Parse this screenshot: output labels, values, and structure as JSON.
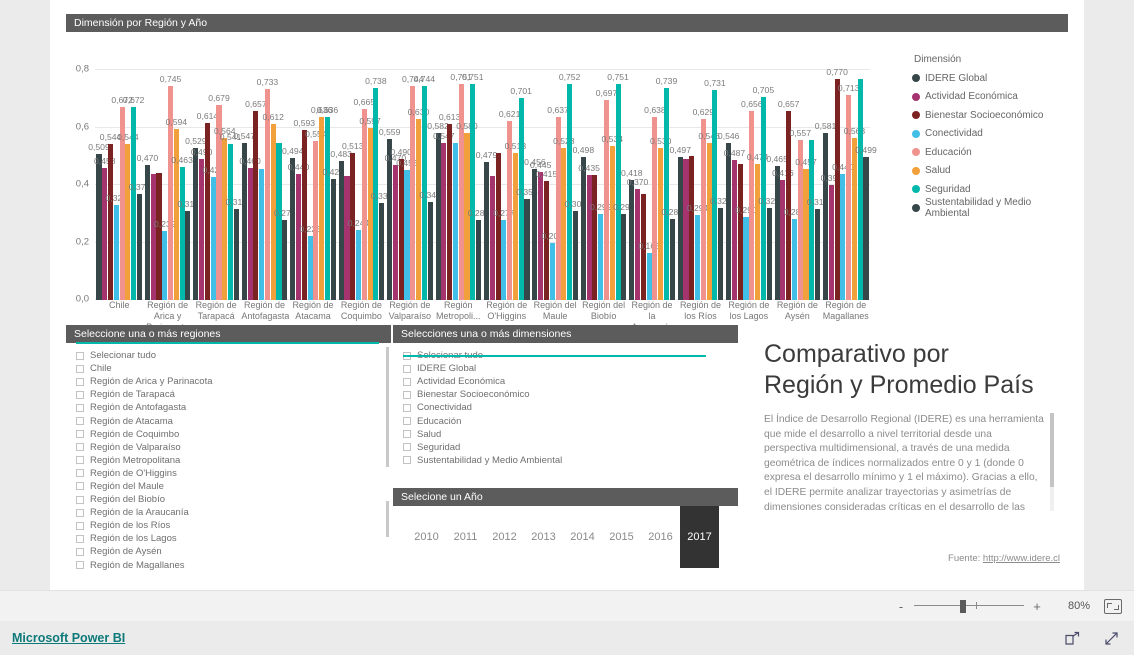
{
  "chart_data": {
    "type": "bar",
    "title": "Dimensión por Región y Año",
    "xlabel": "",
    "ylabel": "",
    "ylim": [
      0,
      0.8
    ],
    "yticks": [
      "0,0",
      "0,2",
      "0,4",
      "0,6",
      "0,8"
    ],
    "grid": true,
    "legend_position": "right",
    "legend_title": "Dimensión",
    "categories": [
      "Chile",
      "Región de Arica y Parinacota",
      "Región de Tarapacá",
      "Región de Antofagasta",
      "Región de Atacama",
      "Región de Coquimbo",
      "Región de Valparaíso",
      "Región Metropoli...",
      "Región de O'Higgins",
      "Región del Maule",
      "Región del Biobío",
      "Región de la Araucanía",
      "Región de los Ríos",
      "Región de los Lagos",
      "Región de Aysén",
      "Región de Magallanes"
    ],
    "series": [
      {
        "name": "IDERE Global",
        "color": "#374649",
        "values": [
          0.509,
          0.47,
          0.529,
          0.547,
          0.494,
          0.483,
          0.559,
          0.582,
          0.479,
          0.456,
          0.498,
          0.418,
          0.497,
          0.546,
          0.465,
          0.581
        ]
      },
      {
        "name": "Actividad Económica",
        "color": "#a4336e",
        "values": [
          0.458,
          0.44,
          0.49,
          0.46,
          0.44,
          0.432,
          0.47,
          0.547,
          0.43,
          0.445,
          0.435,
          0.385,
          0.492,
          0.487,
          0.416,
          0.399
        ]
      },
      {
        "name": "Bienestar Socioeconómico",
        "color": "#7b2222",
        "values": [
          0.544,
          0.441,
          0.614,
          0.657,
          0.593,
          0.513,
          0.49,
          0.613,
          0.513,
          0.415,
          0.436,
          0.37,
          0.5,
          0.474,
          0.657,
          0.77
        ]
      },
      {
        "name": "Conectividad",
        "color": "#41bfe6",
        "values": [
          0.329,
          0.239,
          0.428,
          0.456,
          0.223,
          0.244,
          0.453,
          0.547,
          0.277,
          0.2,
          0.299,
          0.165,
          0.294,
          0.29,
          0.282,
          0.44
        ]
      },
      {
        "name": "Educación",
        "color": "#f0938e",
        "values": [
          0.672,
          0.745,
          0.679,
          0.733,
          0.554,
          0.665,
          0.744,
          0.751,
          0.621,
          0.637,
          0.697,
          0.638,
          0.629,
          0.656,
          0.557,
          0.713
        ]
      },
      {
        "name": "Salud",
        "color": "#f2a03c",
        "values": [
          0.544,
          0.594,
          0.564,
          0.612,
          0.636,
          0.597,
          0.63,
          0.58,
          0.513,
          0.528,
          0.534,
          0.53,
          0.546,
          0.474,
          0.457,
          0.563
        ]
      },
      {
        "name": "Seguridad",
        "color": "#01b8aa",
        "values": [
          0.672,
          0.463,
          0.541,
          0.547,
          0.636,
          0.738,
          0.744,
          0.751,
          0.701,
          0.752,
          0.751,
          0.739,
          0.731,
          0.705,
          0.557,
          0.77
        ]
      },
      {
        "name": "Sustentabilidad y Medio Ambiental",
        "color": "#374649",
        "values": [
          0.37,
          0.311,
          0.316,
          0.278,
          0.421,
          0.337,
          0.34,
          0.28,
          0.353,
          0.309,
          0.299,
          0.281,
          0.321,
          0.321,
          0.316,
          0.499
        ]
      }
    ],
    "data_labels": [
      [
        "0,509",
        "0,458",
        "0,544",
        "0,329",
        "0,672",
        "0,544",
        "0,672",
        "0,370"
      ],
      [
        "0,470",
        "",
        "",
        "0,239",
        "0,745",
        "0,594",
        "0,463",
        "0,311"
      ],
      [
        "0,529",
        "0,490",
        "0,614",
        "0,428",
        "0,679",
        "0,564",
        "0,541",
        "0,316"
      ],
      [
        "0,547",
        "0,460",
        "0,657",
        "",
        "0,733",
        "0,612",
        "",
        "0,278"
      ],
      [
        "0,494",
        "0,440",
        "0,593",
        "0,223",
        "0,554",
        "0,636",
        "0,636",
        "0,421"
      ],
      [
        "0,483",
        "",
        "0,513",
        "0,244",
        "0,665",
        "0,597",
        "0,738",
        "0,337"
      ],
      [
        "0,559",
        "0,470",
        "0,490",
        "0,453",
        "0,744",
        "0,630",
        "0,744",
        "0,340"
      ],
      [
        "0,582",
        "0,547",
        "0,613",
        "",
        "0,751",
        "0,580",
        "0,751",
        "0,280"
      ],
      [
        "0,479",
        "",
        "",
        "0,277",
        "0,621",
        "0,513",
        "0,701",
        "0,353"
      ],
      [
        "0,456",
        "0,445",
        "0,415",
        "0,200",
        "0,637",
        "0,528",
        "0,752",
        "0,309"
      ],
      [
        "0,498",
        "0,435",
        "",
        "0,299",
        "0,697",
        "0,534",
        "0,751",
        "0,299"
      ],
      [
        "0,418",
        "0,370",
        "",
        "0,165",
        "0,638",
        "0,530",
        "0,739",
        "0,281"
      ],
      [
        "0,497",
        "",
        "",
        "0,294",
        "0,629",
        "0,546",
        "0,731",
        "0,321"
      ],
      [
        "0,546",
        "0,487",
        "",
        "0,290",
        "0,656",
        "0,474",
        "0,705",
        "0,321"
      ],
      [
        "0,465",
        "0,416",
        "0,657",
        "0,282",
        "0,557",
        "0,457",
        "",
        "0,316"
      ],
      [
        "0,581",
        "0,399",
        "0,770",
        "0,440",
        "0,713",
        "0,563",
        "",
        "0,499"
      ]
    ]
  },
  "region_slicer": {
    "title": "Seleccione una  o más regiones",
    "items": [
      "Selecionar tudo",
      "Chile",
      "Región de Arica y Parinacota",
      "Región de Tarapacá",
      "Región de Antofagasta",
      "Región de Atacama",
      "Región de Coquimbo",
      "Región de Valparaíso",
      "Región Metropolitana",
      "Región de O'Higgins",
      "Región del Maule",
      "Región del Biobío",
      "Región de la Araucanía",
      "Región de los Ríos",
      "Región de los Lagos",
      "Región de Aysén",
      "Región de Magallanes"
    ]
  },
  "dimension_slicer": {
    "title": "Selecciones una o más dimensiones",
    "items": [
      "Selecionar tudo",
      "IDERE Global",
      "Actividad Económica",
      "Bienestar Socioeconómico",
      "Conectividad",
      "Educación",
      "Salud",
      "Seguridad",
      "Sustentabilidad y Medio Ambiental"
    ]
  },
  "year_slicer": {
    "title": "Selecione un Año",
    "years": [
      "2010",
      "2011",
      "2012",
      "2013",
      "2014",
      "2015",
      "2016",
      "2017"
    ],
    "selected": "2017"
  },
  "text_panel": {
    "headline_line1": "Comparativo por",
    "headline_line2": "Región y Promedio País",
    "body": "El Índice de Desarrollo Regional (IDERE) es una herramienta que mide el desarrollo a nivel territorial desde una perspectiva multidimensional, a través de una medida geométrica de índices normalizados entre 0 y 1 (donde 0 expresa el desarrollo mínimo y 1 el máximo). Gracias a ello, el IDERE permite analizar trayectorias y asimetrías de dimensiones consideradas críticas en el desarrollo de las",
    "source_label": "Fuente: ",
    "source_link": "http://www.idere.cl"
  },
  "zoom_bar": {
    "minus": "-",
    "plus": "+",
    "percent": "80%",
    "fit_icon": "fit-to-page-icon"
  },
  "footer": {
    "brand": "Microsoft Power BI",
    "share_icon": "share-icon",
    "fullscreen_icon": "fullscreen-icon"
  },
  "colors": {
    "accent_teal": "#01b8aa",
    "title_bar": "#5c5c5c",
    "selected_year": "#333333",
    "brand_link": "#0d7a79"
  }
}
